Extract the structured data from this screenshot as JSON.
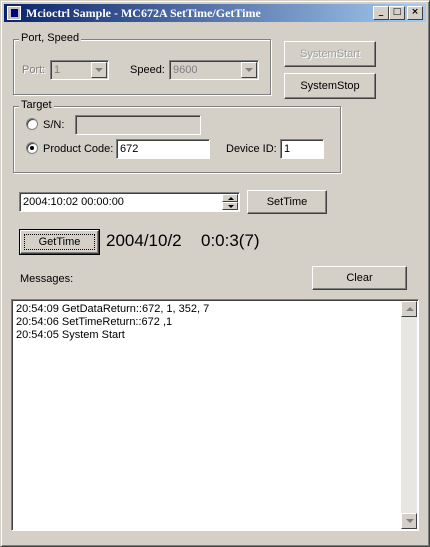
{
  "window": {
    "title": "Mcioctrl Sample - MC672A SetTime/GetTime",
    "minimize_glyph": "_",
    "maximize_glyph": "□",
    "close_glyph": "×"
  },
  "port_speed": {
    "group_label": "Port, Speed",
    "port_label": "Port:",
    "port_value": "1",
    "speed_label": "Speed:",
    "speed_value": "9600"
  },
  "system_buttons": {
    "start_label": "SystemStart",
    "start_enabled": false,
    "stop_label": "SystemStop"
  },
  "target": {
    "group_label": "Target",
    "sn_label": "S/N:",
    "sn_value": "",
    "product_code_label": "Product Code:",
    "product_code_value": "672",
    "device_id_label": "Device ID:",
    "device_id_value": "1",
    "selected": "product_code"
  },
  "datetime": {
    "value": "2004:10:02 00:00:00",
    "settime_label": "SetTime"
  },
  "gettime": {
    "button_label": "GetTime",
    "result_date": "2004/10/2",
    "result_time": "0:0:3(7)"
  },
  "messages": {
    "label": "Messages:",
    "clear_label": "Clear",
    "lines": [
      "20:54:09  GetDataReturn::672, 1, 352, 7",
      "20:54:06  SetTimeReturn::672 ,1",
      "20:54:05  System Start"
    ]
  },
  "colors": {
    "face": "#d4d0c8",
    "title_start": "#0a246a",
    "title_end": "#a6caf0"
  }
}
